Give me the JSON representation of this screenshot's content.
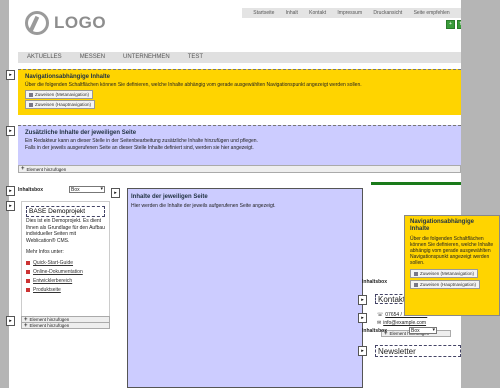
{
  "logo": {
    "text": "LOGO"
  },
  "topnav": {
    "items": [
      "Startseite",
      "Inhalt",
      "Kontakt",
      "Impressum",
      "Druckansicht",
      "Seite empfehlen"
    ]
  },
  "tabs": [
    "AKTUELLES",
    "MESSEN",
    "UNTERNEHMEN",
    "TEST"
  ],
  "nav_panel": {
    "title": "Navigationsabhängige Inhalte",
    "text": "Über die folgenden Schaltflächen können Sie definieren, welche Inhalte abhängig vom gerade ausgewählten Navigationspunkt angezeigt werden sollen.",
    "btn_meta": "Zuweisen (Metanavigation)",
    "btn_haupt": "Zuweisen (Hauptnavigation)"
  },
  "extra_panel": {
    "title": "Zusätzliche Inhalte der jeweiligen Seite",
    "line1": "Ein Redakteur kann an dieser Stelle in der Seitenbearbeitung zusätzliche Inhalte hinzufügen und pflegen.",
    "line2": "Falls in der jeweils ausgerufenen Seite an dieser Stelle Inhalte definiert sind, werden sie hier angezeigt.",
    "add": "Element hinzufügen"
  },
  "left_box": {
    "label": "Inhaltsbox",
    "select": "Box",
    "heading": "BASE Demoprojekt",
    "text": "Dies ist ein Demoprojekt. Es dient Ihnen als Grundlage für den Aufbau individueller Seiten mit Weblication® CMS.",
    "more": "Mehr Infos unter:",
    "links": [
      "Quick-Start-Guide",
      "Online-Dokumentation",
      "Entwicklerbereich",
      "Produktseite"
    ],
    "add_inner": "Element hinzufügen",
    "add_outer": "Element hinzufügen"
  },
  "main": {
    "title": "Inhalte der jeweiligen Seite",
    "text": "Hier werden die Inhalte der jeweils aufgerufenen Seite angezeigt."
  },
  "popup": {
    "title": "Navigationsabhängige Inhalte",
    "text": "Über die folgenden Schaltflächen können Sie definieren, welche Inhalte abhängig vom gerade ausgewählten Navigationspunkt angezeigt werden sollen.",
    "btn_meta": "Zuweisen (Metanavigation)",
    "btn_haupt": "Zuweisen (Hauptnavigation)"
  },
  "right_box1": {
    "label": "Inhaltsbox",
    "heading": "Kontakt",
    "phone": "07654 / 12345-678",
    "email": "info@example.com",
    "add": "Element hinzufügen"
  },
  "right_box2": {
    "label": "Inhaltsbox",
    "select": "Box",
    "heading": "Newsletter"
  },
  "colors": {
    "yellow": "#ffd400",
    "lavender": "#ccccff",
    "green": "#1a7a1a"
  }
}
